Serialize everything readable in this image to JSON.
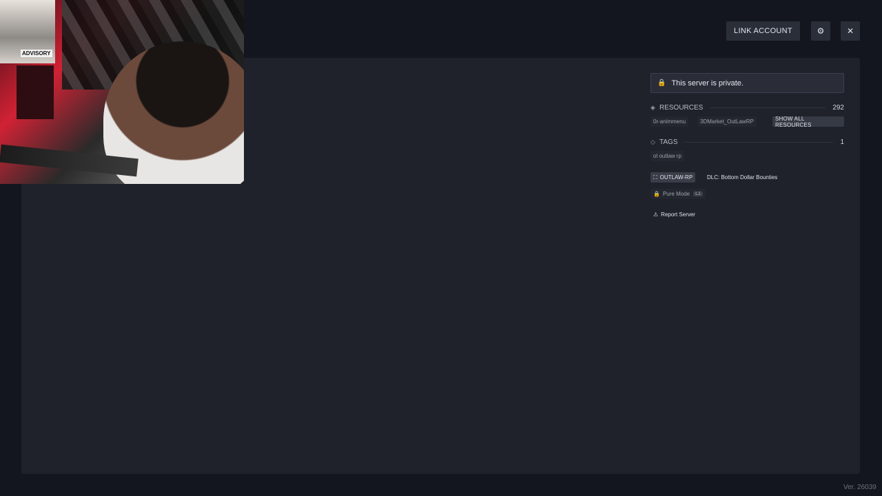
{
  "header": {
    "link_account_label": "LINK ACCOUNT",
    "settings_icon": "gear-icon",
    "close_icon": "close-icon"
  },
  "webcam": {
    "poster_text": "ADVISORY"
  },
  "server_info": {
    "private_notice": "This server is private.",
    "resources": {
      "label": "RESOURCES",
      "count": "292",
      "items": [
        "0r-animmenu",
        "3DMarket_OutLawRP"
      ],
      "show_all_label": "SHOW ALL RESOURCES"
    },
    "tags": {
      "label": "TAGS",
      "count": "1",
      "items": [
        "ol outlaw rp"
      ]
    },
    "game_build_label": "OUTLAW-RP",
    "dlc_label": "DLC: Bottom Dollar Bounties",
    "pure_mode_label": "Pure Mode",
    "pure_mode_level": "L1",
    "report_label": "Report Server"
  },
  "footer": {
    "version": "Ver. 26039"
  },
  "colors": {
    "background": "#13161e",
    "panel": "#1f212b",
    "button": "#2a2e39"
  }
}
